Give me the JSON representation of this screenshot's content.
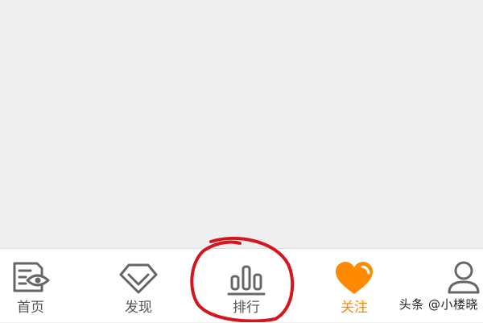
{
  "tab_bar": {
    "tabs": [
      {
        "key": "home",
        "label": "首页",
        "icon": "home-eye-icon",
        "active": false
      },
      {
        "key": "discover",
        "label": "发现",
        "icon": "diamond-icon",
        "active": false
      },
      {
        "key": "rank",
        "label": "排行",
        "icon": "bar-chart-icon",
        "active": false
      },
      {
        "key": "follow",
        "label": "关注",
        "icon": "heart-icon",
        "active": true
      },
      {
        "key": "me",
        "label": "",
        "icon": "user-icon",
        "active": false
      }
    ]
  },
  "colors": {
    "accent": "#ff8a00",
    "icon_gray": "#666666",
    "annotation": "#d6141c"
  },
  "watermark": "头条 @小楼晓"
}
